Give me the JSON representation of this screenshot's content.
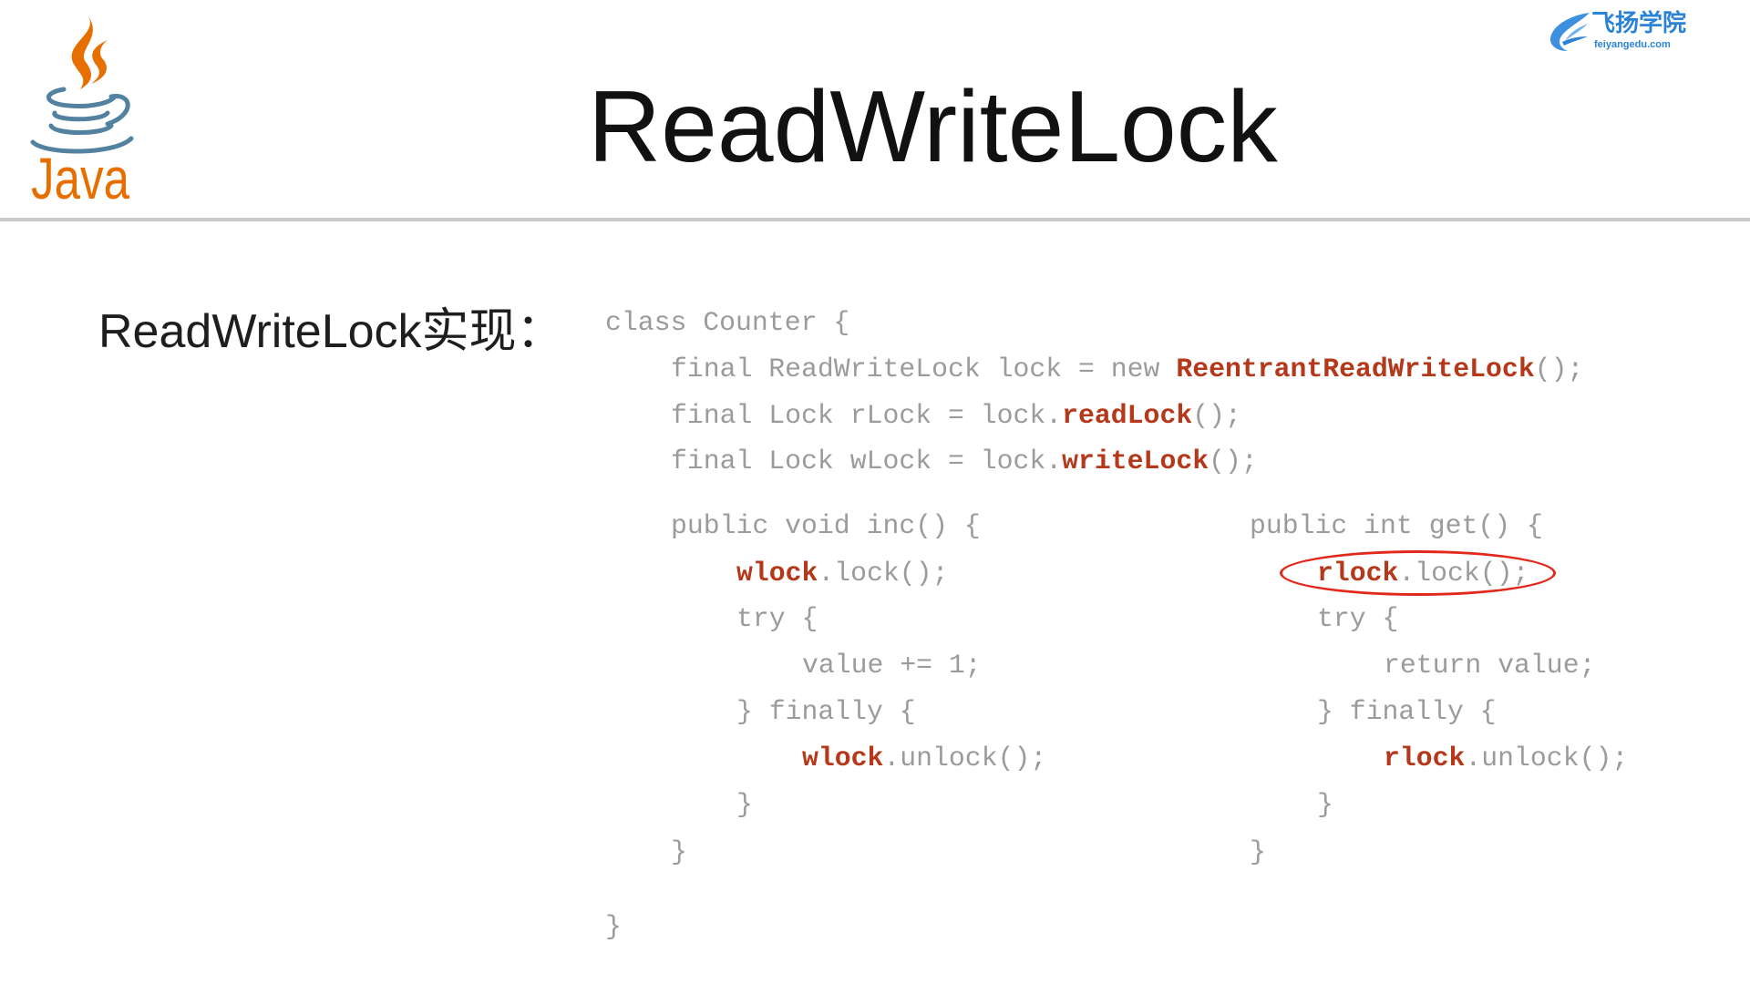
{
  "slide": {
    "title": "ReadWriteLock",
    "subtitle": "ReadWriteLock实现：",
    "java_logo": {
      "text": "Java",
      "icon": "java-coffee-cup-logo"
    },
    "brand": {
      "name": "飞扬学院",
      "domain": "feiyangedu.com",
      "icon": "feiyang-wing-logo"
    }
  },
  "code": {
    "class_open": "class Counter {",
    "fields": [
      {
        "pre": "final ReadWriteLock lock = new ",
        "hl": "ReentrantReadWriteLock",
        "post": "();"
      },
      {
        "pre": "final Lock rLock = lock.",
        "hl": "readLock",
        "post": "();"
      },
      {
        "pre": "final Lock wLock = lock.",
        "hl": "writeLock",
        "post": "();"
      }
    ],
    "inc": {
      "signature": "public void inc() {",
      "lock": {
        "hl": "wlock",
        "post": ".lock();"
      },
      "try": "try {",
      "body": "value += 1;",
      "finally": "} finally {",
      "unlock": {
        "hl": "wlock",
        "post": ".unlock();"
      },
      "finally_close": "}",
      "close": "}"
    },
    "get": {
      "signature": "public int get() {",
      "lock": {
        "hl": "rlock",
        "post": ".lock();"
      },
      "try": "try {",
      "body": "return value;",
      "finally": "} finally {",
      "unlock": {
        "hl": "rlock",
        "post": ".unlock();"
      },
      "finally_close": "}",
      "close": "}"
    },
    "class_close": "}"
  },
  "colors": {
    "code_text": "#9b9b9b",
    "code_highlight": "#b5381b",
    "annotation_circle": "#e2281b",
    "java_orange": "#e76f00",
    "java_blue": "#5382a1",
    "brand_blue": "#2b83d6"
  }
}
